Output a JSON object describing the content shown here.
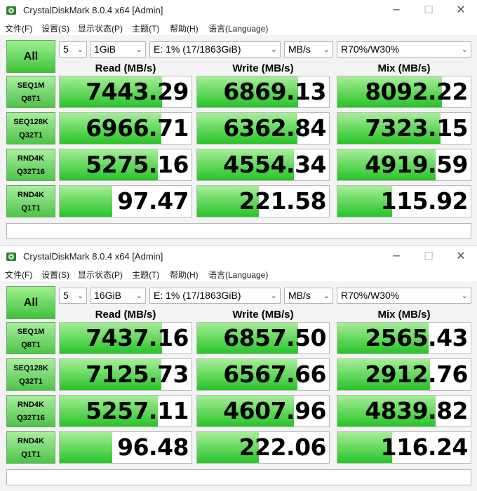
{
  "app": {
    "title": "CrystalDiskMark 8.0.4 x64 [Admin]",
    "window_controls": {
      "minimize": "─",
      "maximize": "☐",
      "close": "✕"
    },
    "menu": [
      "文件(F)",
      "设置(S)",
      "显示状态(P)",
      "主题(T)",
      "帮助(H)",
      "语言(Language)"
    ],
    "all_label": "All",
    "columns": [
      "Read (MB/s)",
      "Write (MB/s)",
      "Mix (MB/s)"
    ],
    "tests": [
      {
        "name": "SEQ1M",
        "sub": "Q8T1"
      },
      {
        "name": "SEQ128K",
        "sub": "Q32T1"
      },
      {
        "name": "RND4K",
        "sub": "Q32T16"
      },
      {
        "name": "RND4K",
        "sub": "Q1T1"
      }
    ],
    "accent_colors": {
      "bar_light": "#a6ee98",
      "bar_dark": "#27c427",
      "button_green": "#3fc33a"
    },
    "icons": {
      "app": "crystaldiskmark-icon",
      "dropdown": "chevron-down-icon"
    }
  },
  "windows": [
    {
      "count": "5",
      "size": "1GiB",
      "drive": "E: 1% (17/1863GiB)",
      "unit": "MB/s",
      "mix": "R70%/W30%",
      "results": [
        [
          "7443.29",
          "6869.13",
          "8092.22"
        ],
        [
          "6966.71",
          "6362.84",
          "7323.15"
        ],
        [
          "5275.16",
          "4554.34",
          "4919.59"
        ],
        [
          "97.47",
          "221.58",
          "115.92"
        ]
      ],
      "comment": ""
    },
    {
      "count": "5",
      "size": "16GiB",
      "drive": "E: 1% (17/1863GiB)",
      "unit": "MB/s",
      "mix": "R70%/W30%",
      "results": [
        [
          "7437.16",
          "6857.50",
          "2565.43"
        ],
        [
          "7125.73",
          "6567.66",
          "2912.76"
        ],
        [
          "5257.11",
          "4607.96",
          "4839.82"
        ],
        [
          "96.48",
          "222.06",
          "116.24"
        ]
      ],
      "comment": ""
    }
  ]
}
